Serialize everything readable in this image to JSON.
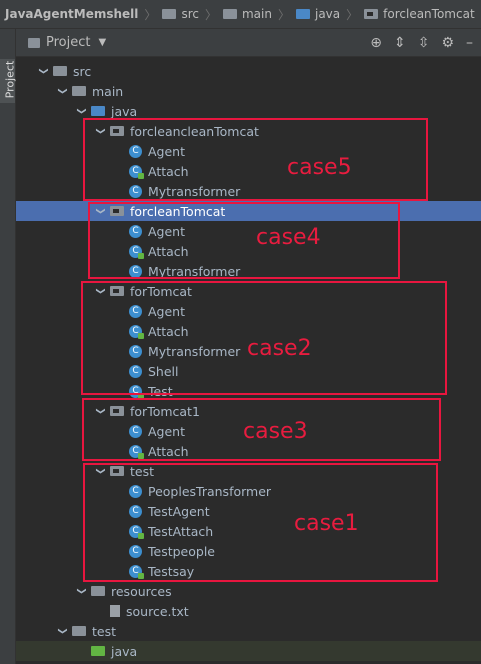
{
  "breadcrumb": [
    "JavaAgentMemshell",
    "src",
    "main",
    "java",
    "forcleanTomcat"
  ],
  "sidebar": {
    "vertical_tab": "Project"
  },
  "toolbar": {
    "title": "Project"
  },
  "tree": [
    {
      "label": "src",
      "depth": 1,
      "icon": "folder-gray",
      "arrow": "down"
    },
    {
      "label": "main",
      "depth": 2,
      "icon": "folder-gray",
      "arrow": "down"
    },
    {
      "label": "java",
      "depth": 3,
      "icon": "folder-blue",
      "arrow": "down"
    },
    {
      "label": "forcleancleanTomcat",
      "depth": 4,
      "icon": "package",
      "arrow": "down"
    },
    {
      "label": "Agent",
      "depth": 5,
      "icon": "class"
    },
    {
      "label": "Attach",
      "depth": 5,
      "icon": "class-main"
    },
    {
      "label": "Mytransformer",
      "depth": 5,
      "icon": "class"
    },
    {
      "label": "forcleanTomcat",
      "depth": 4,
      "icon": "package",
      "arrow": "down",
      "selected": true
    },
    {
      "label": "Agent",
      "depth": 5,
      "icon": "class"
    },
    {
      "label": "Attach",
      "depth": 5,
      "icon": "class-main"
    },
    {
      "label": "Mytransformer",
      "depth": 5,
      "icon": "class"
    },
    {
      "label": "forTomcat",
      "depth": 4,
      "icon": "package",
      "arrow": "down"
    },
    {
      "label": "Agent",
      "depth": 5,
      "icon": "class"
    },
    {
      "label": "Attach",
      "depth": 5,
      "icon": "class-main"
    },
    {
      "label": "Mytransformer",
      "depth": 5,
      "icon": "class"
    },
    {
      "label": "Shell",
      "depth": 5,
      "icon": "class"
    },
    {
      "label": "Test",
      "depth": 5,
      "icon": "class-main"
    },
    {
      "label": "forTomcat1",
      "depth": 4,
      "icon": "package",
      "arrow": "down"
    },
    {
      "label": "Agent",
      "depth": 5,
      "icon": "class"
    },
    {
      "label": "Attach",
      "depth": 5,
      "icon": "class-main"
    },
    {
      "label": "test",
      "depth": 4,
      "icon": "package",
      "arrow": "down"
    },
    {
      "label": "PeoplesTransformer",
      "depth": 5,
      "icon": "class"
    },
    {
      "label": "TestAgent",
      "depth": 5,
      "icon": "class"
    },
    {
      "label": "TestAttach",
      "depth": 5,
      "icon": "class-main"
    },
    {
      "label": "Testpeople",
      "depth": 5,
      "icon": "class"
    },
    {
      "label": "Testsay",
      "depth": 5,
      "icon": "class-main"
    },
    {
      "label": "resources",
      "depth": 3,
      "icon": "folder-res",
      "arrow": "down"
    },
    {
      "label": "source.txt",
      "depth": 4,
      "icon": "file-txt"
    },
    {
      "label": "test",
      "depth": 2,
      "icon": "folder-gray",
      "arrow": "down"
    },
    {
      "label": "java",
      "depth": 3,
      "icon": "folder-green",
      "greenbg": true
    }
  ],
  "annotations": [
    "case5",
    "case4",
    "case2",
    "case3",
    "case1"
  ]
}
